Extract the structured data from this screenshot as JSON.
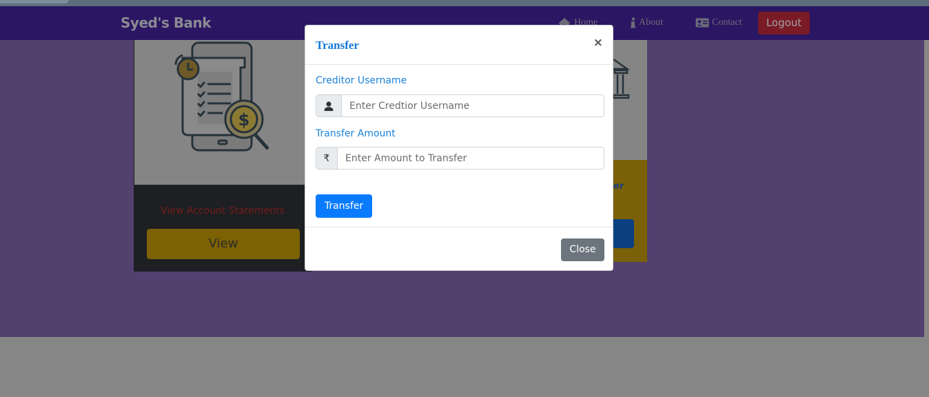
{
  "navbar": {
    "brand": "Syed's Bank",
    "items": [
      {
        "label": "Home",
        "icon": "home-icon"
      },
      {
        "label": "About",
        "icon": "info-icon"
      },
      {
        "label": "Contact",
        "icon": "contact-card-icon"
      }
    ],
    "logout_label": "Logout"
  },
  "cards": {
    "statements": {
      "caption": "View Account Statements",
      "button_label": "View",
      "icon": "statement-dollar-icon"
    },
    "transfer_partial": {
      "caption_fragment": "er",
      "icon": "bank-building-icon"
    }
  },
  "modal": {
    "title": "Transfer",
    "close_symbol": "×",
    "fields": {
      "creditor": {
        "label": "Creditor Username",
        "placeholder": "Enter Credtior Username",
        "value": "",
        "icon": "user-icon"
      },
      "amount": {
        "label": "Transfer Amount",
        "placeholder": "Enter Amount to Transfer",
        "value": "",
        "icon": "rupee-icon",
        "symbol": "₹"
      }
    },
    "submit_label": "Transfer",
    "close_label": "Close"
  },
  "colors": {
    "navbar": "#2a1663",
    "page_background": "#53406e",
    "modal_title": "#1478d8",
    "label": "#1b82d8",
    "primary_button": "#0a7bff",
    "secondary_button": "#6c757d"
  }
}
